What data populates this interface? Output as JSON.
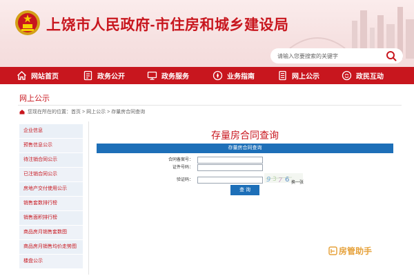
{
  "header": {
    "title": "上饶市人民政府-市住房和城乡建设局",
    "search": {
      "placeholder": "请输入您要搜索的关键字"
    }
  },
  "nav": {
    "items": [
      {
        "label": "网站首页",
        "icon": "home-icon"
      },
      {
        "label": "政务公开",
        "icon": "document-icon"
      },
      {
        "label": "政务服务",
        "icon": "monitor-icon"
      },
      {
        "label": "业务指南",
        "icon": "compass-icon"
      },
      {
        "label": "网上公示",
        "icon": "notice-icon"
      },
      {
        "label": "政民互动",
        "icon": "chat-icon"
      }
    ]
  },
  "section": {
    "title": "网上公示",
    "breadcrumb": {
      "prefix": "您现在所在的位置：",
      "crumbs": [
        "首页",
        "网上公示",
        "存量房合同查询"
      ],
      "separator": ">"
    }
  },
  "sidebar": {
    "items": [
      {
        "label": "企业信息"
      },
      {
        "label": "预售信息公示"
      },
      {
        "label": "待注销合同公示"
      },
      {
        "label": "已注销合同公示"
      },
      {
        "label": "房地产交付使用公示"
      },
      {
        "label": "销售套数排行榜"
      },
      {
        "label": "销售面积排行榜"
      },
      {
        "label": "商品房月销售套数图"
      },
      {
        "label": "商品房月销售均价走势图"
      },
      {
        "label": "楼盘公示"
      }
    ]
  },
  "form": {
    "heading": "存量房合同查询",
    "bar_label": "存量房合同查询",
    "fields": [
      {
        "label": "合同备案号：",
        "value": ""
      },
      {
        "label": "证件号码：",
        "value": ""
      },
      {
        "label": "验证码：",
        "value": ""
      }
    ],
    "captcha_text": "9…6",
    "captcha_refresh": "换一张",
    "submit_label": "查 询"
  },
  "watermark": {
    "text": "房管助手"
  },
  "colors": {
    "brand_red": "#c8161e",
    "accent_blue": "#1d6fb8",
    "watermark": "#e6a23c"
  }
}
